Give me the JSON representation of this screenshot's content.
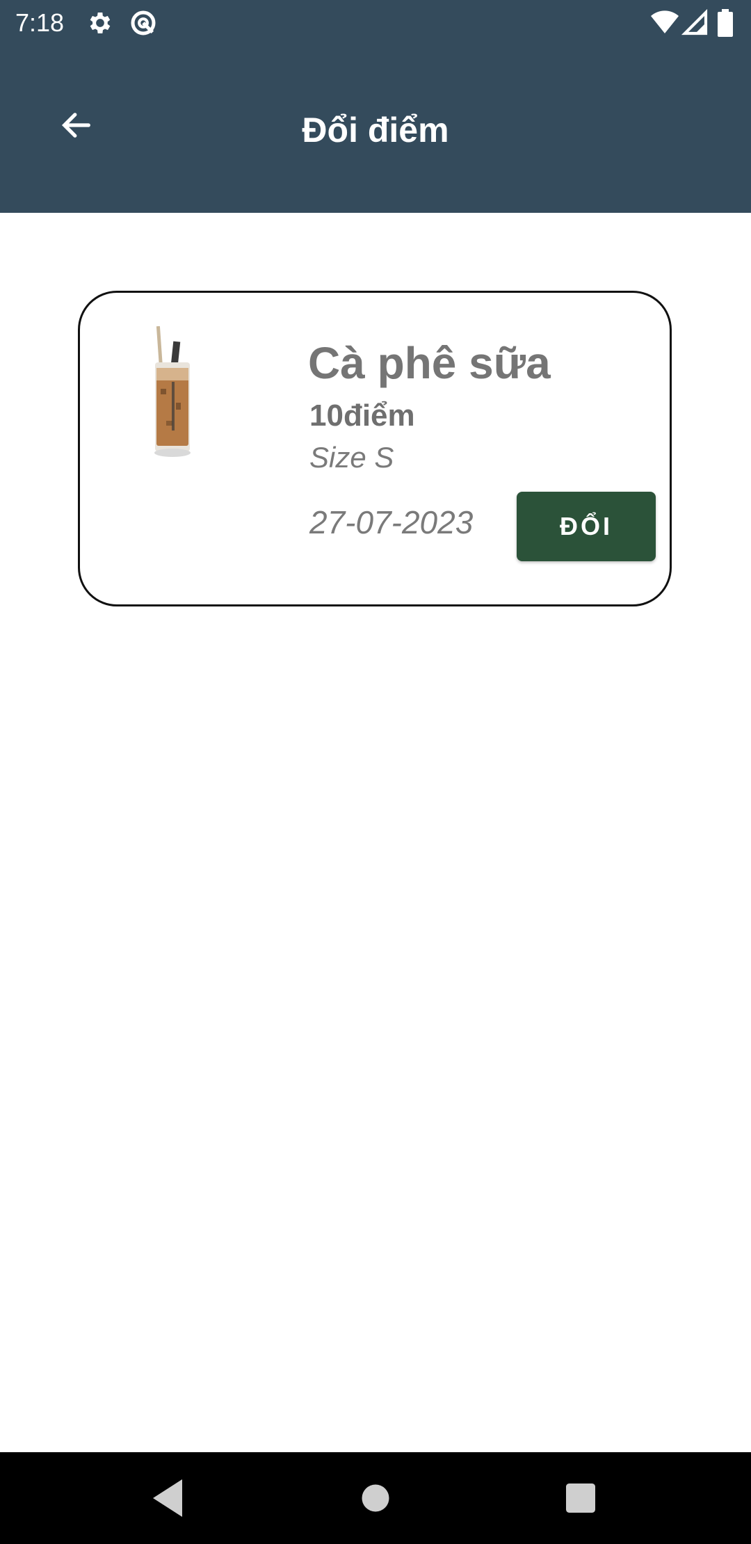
{
  "status_bar": {
    "time": "7:18",
    "icons": [
      "gear-icon",
      "data-saver-icon",
      "wifi-icon",
      "cellular-signal-icon",
      "battery-icon"
    ]
  },
  "toolbar": {
    "title": "Đổi điểm",
    "back_icon": "arrow-left-icon"
  },
  "reward_card": {
    "name": "Cà phê sữa",
    "points": "10điểm",
    "size": "Size S",
    "date": "27-07-2023",
    "redeem_label": "ĐỔI",
    "image_icon": "iced-coffee-glass-icon"
  },
  "nav_bar": {
    "buttons": [
      "back-triangle-icon",
      "home-circle-icon",
      "recents-square-icon"
    ]
  },
  "colors": {
    "toolbar": "#344b5c",
    "redeem_button": "#2b5239",
    "card_border": "#111111",
    "text_gray": "#757575",
    "nav_bar": "#000000"
  }
}
